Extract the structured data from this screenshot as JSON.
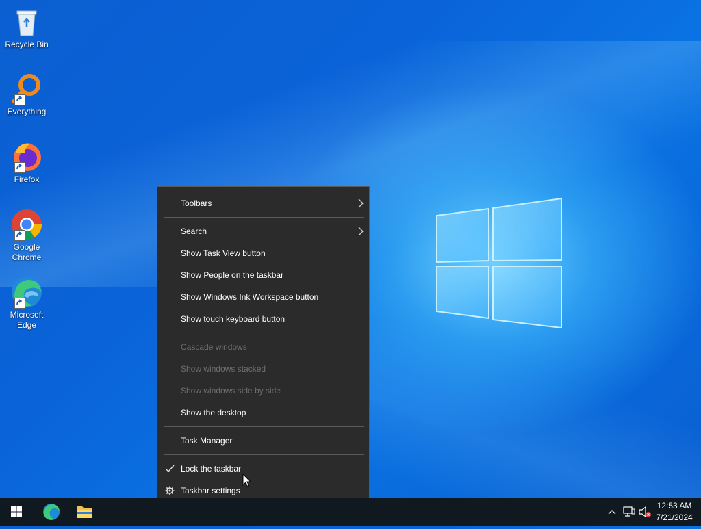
{
  "desktop": {
    "icons": [
      {
        "label": "Recycle Bin",
        "icon": "recycle-bin-icon"
      },
      {
        "label": "Everything",
        "icon": "everything-search-icon"
      },
      {
        "label": "Firefox",
        "icon": "firefox-icon"
      },
      {
        "label_line1": "Google",
        "label_line2": "Chrome",
        "icon": "chrome-icon"
      },
      {
        "label_line1": "Microsoft",
        "label_line2": "Edge",
        "icon": "edge-icon"
      }
    ]
  },
  "context_menu": {
    "items": [
      {
        "label": "Toolbars",
        "submenu": true,
        "enabled": true
      },
      {
        "label": "Search",
        "submenu": true,
        "enabled": true
      },
      {
        "label": "Show Task View button",
        "enabled": true
      },
      {
        "label": "Show People on the taskbar",
        "enabled": true
      },
      {
        "label": "Show Windows Ink Workspace button",
        "enabled": true
      },
      {
        "label": "Show touch keyboard button",
        "enabled": true
      },
      {
        "label": "Cascade windows",
        "enabled": false
      },
      {
        "label": "Show windows stacked",
        "enabled": false
      },
      {
        "label": "Show windows side by side",
        "enabled": false
      },
      {
        "label": "Show the desktop",
        "enabled": true
      },
      {
        "label": "Task Manager",
        "enabled": true
      },
      {
        "label": "Lock the taskbar",
        "enabled": true,
        "checked": true
      },
      {
        "label": "Taskbar settings",
        "enabled": true,
        "icon": "gear-icon"
      }
    ]
  },
  "taskbar": {
    "pinned": [
      "start-icon",
      "edge-icon",
      "file-explorer-icon"
    ],
    "tray_icons": [
      "chevron-up-icon",
      "network-icon",
      "volume-muted-icon"
    ],
    "time": "12:53 AM",
    "date": "7/21/2024"
  },
  "colors": {
    "menu_bg": "#2b2b2b",
    "taskbar_bg": "#101820",
    "accent": "#0a63d8"
  }
}
